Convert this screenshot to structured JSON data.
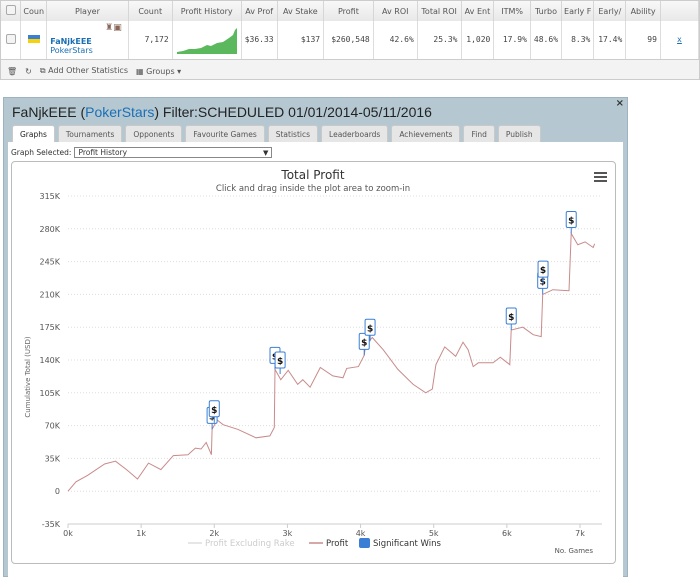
{
  "stats_table": {
    "columns": [
      "Coun",
      "Player",
      "Count",
      "Profit History",
      "Av Prof",
      "Av Stake",
      "Profit",
      "Av ROI",
      "Total ROI",
      "Av Ent",
      "ITM%",
      "Turbo",
      "Early F",
      "Early/",
      "Ability"
    ],
    "row": {
      "player": "FaNjkEEE",
      "site": "PokerStars",
      "count": "7,172",
      "av_profit": "$36.33",
      "av_stake": "$137",
      "profit": "$260,548",
      "av_roi": "42.6%",
      "total_roi": "25.3%",
      "av_ent": "1,020",
      "itm": "17.9%",
      "turbo": "48.6%",
      "early_f": "8.3%",
      "early_a": "17.4%",
      "ability": "99",
      "remove": "x"
    }
  },
  "toolbar": {
    "add_stats": "Add Other Statistics",
    "groups": "Groups"
  },
  "dialog": {
    "title_player": "FaNjkEEE (",
    "title_site": "PokerStars",
    "title_filter": ") Filter:SCHEDULED 01/01/2014-05/11/2016",
    "close": "×",
    "tabs": [
      "Graphs",
      "Tournaments",
      "Opponents",
      "Favourite Games",
      "Statistics",
      "Leaderboards",
      "Achievements",
      "Find",
      "Publish"
    ],
    "graph_selected_label": "Graph Selected:",
    "graph_selected_value": "Profit History"
  },
  "colors": {
    "profit_line": "#c98a8a",
    "significant_wins": "#3a7fd5",
    "dialog_header": "#b5c8d2",
    "link": "#1a6fb5"
  },
  "chart_data": {
    "type": "line",
    "title": "Total Profit",
    "subtitle": "Click and drag inside the plot area to zoom-in",
    "ylabel": "Cumulative Total (USD)",
    "xlabel": "No. Games",
    "ylim": [
      -35000,
      315000
    ],
    "yticks": [
      "-35K",
      "0",
      "35K",
      "70K",
      "105K",
      "140K",
      "175K",
      "210K",
      "245K",
      "280K",
      "315K"
    ],
    "xlim": [
      0,
      7200
    ],
    "xticks": [
      "0k",
      "1k",
      "2k",
      "3k",
      "4k",
      "5k",
      "6k",
      "7k"
    ],
    "grid": true,
    "legend": {
      "placement": "bottom",
      "items": [
        "Profit Excluding Rake",
        "Profit",
        "Significant Wins"
      ]
    },
    "series": [
      {
        "name": "Profit",
        "x": [
          0,
          110,
          270,
          500,
          650,
          800,
          950,
          1100,
          1270,
          1440,
          1640,
          1740,
          1820,
          1890,
          1960,
          1970,
          2040,
          2120,
          2320,
          2570,
          2760,
          2820,
          2830,
          2910,
          3010,
          3140,
          3210,
          3310,
          3450,
          3620,
          3760,
          3810,
          3970,
          4050,
          4070,
          4160,
          4310,
          4510,
          4720,
          4890,
          4980,
          5030,
          5150,
          5300,
          5400,
          5470,
          5540,
          5610,
          5810,
          5910,
          6040,
          6060,
          6220,
          6360,
          6470,
          6490,
          6630,
          6850,
          6880,
          6970,
          7070,
          7180,
          7200
        ],
        "y": [
          0,
          10000,
          17000,
          29000,
          32000,
          23000,
          13000,
          30000,
          23000,
          38000,
          39000,
          46000,
          45000,
          52000,
          39000,
          66000,
          76000,
          71000,
          66000,
          57000,
          59000,
          68000,
          130000,
          119000,
          129000,
          114000,
          119000,
          111000,
          132000,
          123000,
          121000,
          131000,
          133000,
          145000,
          156000,
          164000,
          151000,
          130000,
          114000,
          105000,
          109000,
          135000,
          154000,
          144000,
          159000,
          151000,
          133000,
          137000,
          137000,
          143000,
          135000,
          172000,
          175000,
          167000,
          165000,
          210000,
          215000,
          214000,
          275000,
          263000,
          266000,
          260000,
          264000
        ]
      }
    ],
    "significant_wins": [
      {
        "x": 1970,
        "y": 66000,
        "label": "$"
      },
      {
        "x": 2000,
        "y": 73000,
        "label": "$"
      },
      {
        "x": 2830,
        "y": 130000,
        "label": "$"
      },
      {
        "x": 2900,
        "y": 125000,
        "label": "$"
      },
      {
        "x": 4050,
        "y": 145000,
        "label": "$"
      },
      {
        "x": 4130,
        "y": 160000,
        "label": "$"
      },
      {
        "x": 6060,
        "y": 172000,
        "label": "$"
      },
      {
        "x": 6490,
        "y": 210000,
        "label": "$"
      },
      {
        "x": 6495,
        "y": 222000,
        "label": "$"
      },
      {
        "x": 6880,
        "y": 275000,
        "label": "$"
      }
    ]
  }
}
